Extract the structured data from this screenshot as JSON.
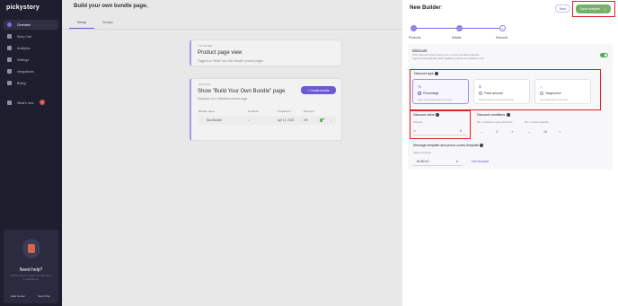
{
  "sidebar": {
    "logo": "pickystory",
    "items": [
      {
        "label": "Overview"
      },
      {
        "label": "Story Cart"
      },
      {
        "label": "Analytics"
      },
      {
        "label": "Settings"
      },
      {
        "label": "Integrations"
      },
      {
        "label": "Billing"
      },
      {
        "label": "What's new"
      }
    ],
    "whats_new_badge": "1",
    "help": {
      "title": "Need help?",
      "subtitle": "Find the info you need in our help center or chat with us.",
      "help_center": "Help Center",
      "start_chat": "Start Chat"
    }
  },
  "main": {
    "title": "Build your own bundle page",
    "tabs": [
      {
        "label": "Setup"
      },
      {
        "label": "Design"
      }
    ],
    "card1": {
      "tag": "TRIGGER",
      "title": "Product page view",
      "subtitle": "Triggers on \"Build Your Own Bundle\" product pages"
    },
    "card2": {
      "tag": "ACTION",
      "title": "Show \"Build Your Own Bundle\" page",
      "subtitle": "Displayed on a dedicated product page",
      "create_label": "+ Create bundle",
      "columns": [
        "Bundle name",
        "Products",
        "Created on",
        "Discount"
      ],
      "row": {
        "name": "New Builder",
        "products": "–",
        "created": "Apr 17, 2024",
        "discount": "0%",
        "more": "⋮"
      }
    }
  },
  "panel": {
    "title": "New Builder",
    "back_label": "Back",
    "save_label": "Save changes",
    "steps": [
      {
        "label": "Products"
      },
      {
        "label": "Details"
      },
      {
        "label": "Discount"
      }
    ],
    "discount": {
      "title": "Discount",
      "subtitle_line1": "Offer discount when buying one or more bundled products.",
      "subtitle_line2": "Applied automatically when eligible products are added to cart."
    },
    "discount_type": {
      "label": "Discount type",
      "options": [
        {
          "icon": "%",
          "label": "Percentage",
          "desc": "Apply a percentage discount to cart"
        },
        {
          "icon": "$",
          "label": "Fixed amount",
          "desc": "Reduce cart price by a fixed amount"
        },
        {
          "icon": "tag",
          "label": "Target price",
          "desc": "Set a target price for the deal"
        }
      ]
    },
    "discount_value": {
      "label": "Discount value",
      "sub": "Percent",
      "prefix": "%",
      "value": "5"
    },
    "conditions": {
      "label": "Discount conditions",
      "min_products_label": "Min. products to get a discount",
      "min_products_value": "3",
      "min_qty_label": "Min. product quantity",
      "min_qty_value": "10"
    },
    "message": {
      "label": "Message template and promo codes template",
      "select_label": "Select template",
      "select_value": "BUNDLE",
      "edit_label": "Edit template"
    }
  }
}
